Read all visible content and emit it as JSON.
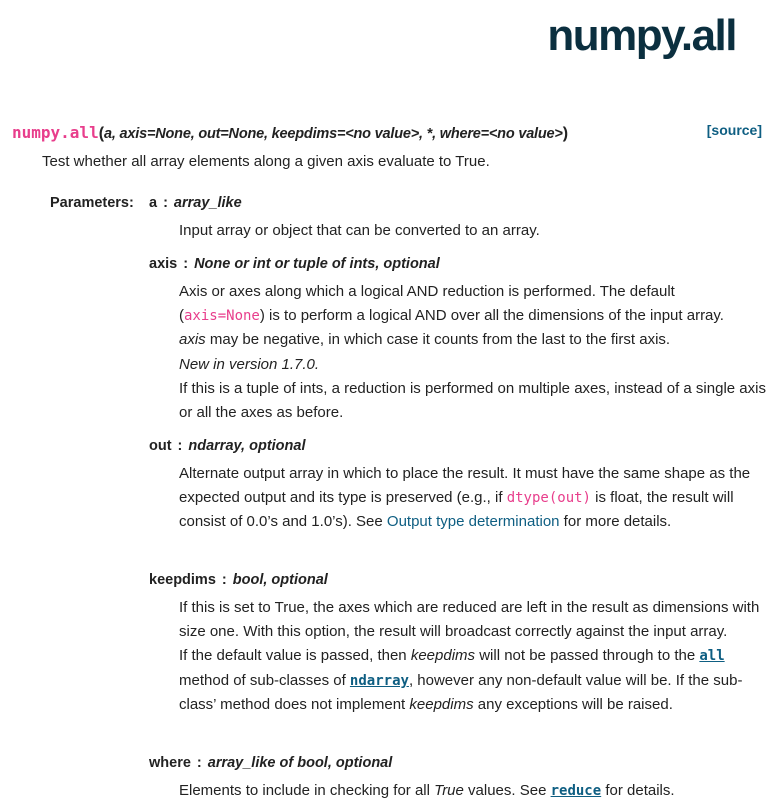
{
  "page_title": "numpy.all",
  "signature": {
    "name": "numpy.all",
    "open_paren": "(",
    "params": "a, axis=None, out=None, keepdims=<no value>, *, where=<no value>",
    "close_paren": ")",
    "source_label": "[source]"
  },
  "summary": "Test whether all array elements along a given axis evaluate to True.",
  "parameters_label": "Parameters:",
  "parameters": {
    "a": {
      "name": "a",
      "sep": ":",
      "type": "array_like",
      "desc": "Input array or object that can be converted to an array."
    },
    "axis": {
      "name": "axis",
      "sep": ":",
      "type": "None or int or tuple of ints, optional",
      "line1": "Axis or axes along which a logical AND reduction is performed. The default",
      "paren_open": "(",
      "code": "axis=None",
      "line2_rest": ") is to perform a logical AND over all the dimensions of the input array.",
      "em1": "axis",
      "line3_rest": " may be negative, in which case it counts from the last to the first axis.",
      "version_note": "New in version 1.7.0.",
      "line5": "If this is a tuple of ints, a reduction is performed on multiple axes, instead of a single axis or all the axes as before."
    },
    "out": {
      "name": "out",
      "sep": ":",
      "type": "ndarray, optional",
      "text1": "Alternate output array in which to place the result. It must have the same shape as the expected output and its type is preserved (e.g., if ",
      "code": "dtype(out)",
      "text2": " is float, the result will consist of 0.0’s and 1.0’s). See ",
      "link": "Output type determination",
      "text3": " for more details."
    },
    "keepdims": {
      "name": "keepdims",
      "sep": ":",
      "type": "bool, optional",
      "para1": "If this is set to True, the axes which are reduced are left in the result as dimensions with size one. With this option, the result will broadcast correctly against the input array.",
      "t1": "If the default value is passed, then ",
      "em1": "keepdims",
      "t2": " will not be passed through to the ",
      "code1": "all",
      "t3": " method of sub-classes of ",
      "code2": "ndarray",
      "t4": ", however any non-default value will be. If the sub-class’ method does not implement ",
      "em2": "keepdims",
      "t5": " any exceptions will be raised."
    },
    "where": {
      "name": "where",
      "sep": ":",
      "type": "array_like of bool, optional",
      "t1": "Elements to include in checking for all ",
      "em1": "True",
      "t2": " values. See ",
      "code1": "reduce",
      "t3": " for details."
    }
  }
}
